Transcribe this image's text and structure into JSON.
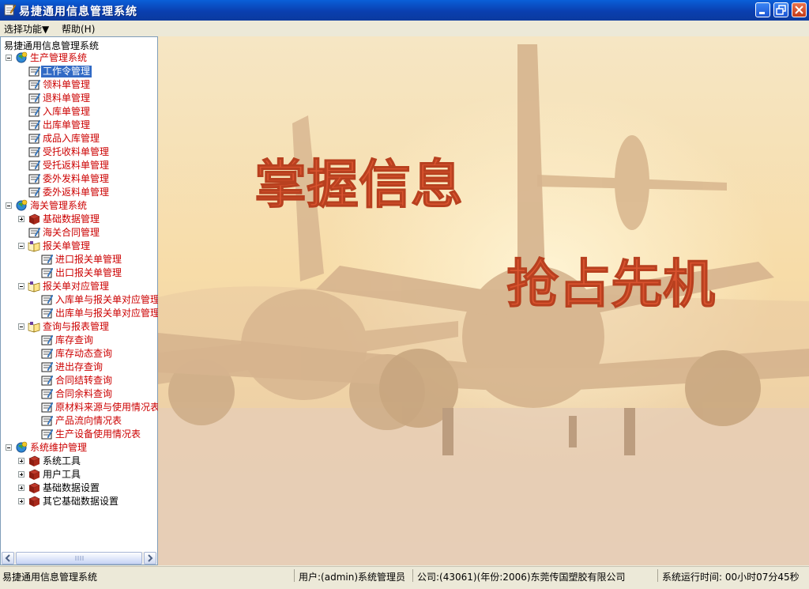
{
  "window": {
    "title": "易捷通用信息管理系统"
  },
  "menubar": {
    "items": [
      "选择功能▼",
      "帮助(H)"
    ]
  },
  "panel": {
    "title": "易捷通用信息管理系统"
  },
  "tree": [
    {
      "label": "生产管理系统",
      "level": 0,
      "icon": "globe-icon",
      "expander": "minus"
    },
    {
      "label": "工作令管理",
      "level": 1,
      "icon": "form-icon",
      "selected": true
    },
    {
      "label": "领料单管理",
      "level": 1,
      "icon": "form-icon"
    },
    {
      "label": "退料单管理",
      "level": 1,
      "icon": "form-icon"
    },
    {
      "label": "入库单管理",
      "level": 1,
      "icon": "form-icon"
    },
    {
      "label": "出库单管理",
      "level": 1,
      "icon": "form-icon"
    },
    {
      "label": "成品入库管理",
      "level": 1,
      "icon": "form-icon"
    },
    {
      "label": "受托收料单管理",
      "level": 1,
      "icon": "form-icon"
    },
    {
      "label": "受托返料单管理",
      "level": 1,
      "icon": "form-icon"
    },
    {
      "label": "委外发料单管理",
      "level": 1,
      "icon": "form-icon"
    },
    {
      "label": "委外返料单管理",
      "level": 1,
      "icon": "form-icon"
    },
    {
      "label": "海关管理系统",
      "level": 0,
      "icon": "globe-icon",
      "expander": "minus"
    },
    {
      "label": "基础数据管理",
      "level": 1,
      "icon": "book-icon",
      "expander": "plus"
    },
    {
      "label": "海关合同管理",
      "level": 1,
      "icon": "form-icon"
    },
    {
      "label": "报关单管理",
      "level": 1,
      "icon": "open-book-icon",
      "expander": "minus"
    },
    {
      "label": "进口报关单管理",
      "level": 2,
      "icon": "form-icon"
    },
    {
      "label": "出口报关单管理",
      "level": 2,
      "icon": "form-icon"
    },
    {
      "label": "报关单对应管理",
      "level": 1,
      "icon": "open-book-icon",
      "expander": "minus"
    },
    {
      "label": "入库单与报关单对应管理",
      "level": 2,
      "icon": "form-icon"
    },
    {
      "label": "出库单与报关单对应管理",
      "level": 2,
      "icon": "form-icon"
    },
    {
      "label": "查询与报表管理",
      "level": 1,
      "icon": "open-book-icon",
      "expander": "minus"
    },
    {
      "label": "库存查询",
      "level": 2,
      "icon": "form-icon"
    },
    {
      "label": "库存动态查询",
      "level": 2,
      "icon": "form-icon"
    },
    {
      "label": "进出存查询",
      "level": 2,
      "icon": "form-icon"
    },
    {
      "label": "合同结转查询",
      "level": 2,
      "icon": "form-icon"
    },
    {
      "label": "合同余料查询",
      "level": 2,
      "icon": "form-icon"
    },
    {
      "label": "原材料来源与使用情况表",
      "level": 2,
      "icon": "form-icon"
    },
    {
      "label": "产品流向情况表",
      "level": 2,
      "icon": "form-icon"
    },
    {
      "label": "生产设备使用情况表",
      "level": 2,
      "icon": "form-icon"
    },
    {
      "label": "系统维护管理",
      "level": 0,
      "icon": "globe-icon",
      "expander": "minus"
    },
    {
      "label": "系统工具",
      "level": 1,
      "icon": "book-icon",
      "expander": "plus",
      "black": true
    },
    {
      "label": "用户工具",
      "level": 1,
      "icon": "book-icon",
      "expander": "plus",
      "black": true
    },
    {
      "label": "基础数据设置",
      "level": 1,
      "icon": "book-icon",
      "expander": "plus",
      "black": true
    },
    {
      "label": "其它基础数据设置",
      "level": 1,
      "icon": "book-icon",
      "expander": "plus",
      "black": true
    }
  ],
  "banner": {
    "line1": "掌握信息",
    "line2": "抢占先机",
    "text_color": "#d9532f"
  },
  "status": {
    "app": "易捷通用信息管理系统",
    "user": "用户:(admin)系统管理员",
    "company": "公司:(43061)(年份:2006)东莞传国塑胶有限公司",
    "uptime": "系统运行时间: 00小时07分45秒"
  },
  "colors": {
    "titlebar": "#0a3fb0",
    "tree_text": "#cc0000",
    "selection": "#316ac5"
  }
}
